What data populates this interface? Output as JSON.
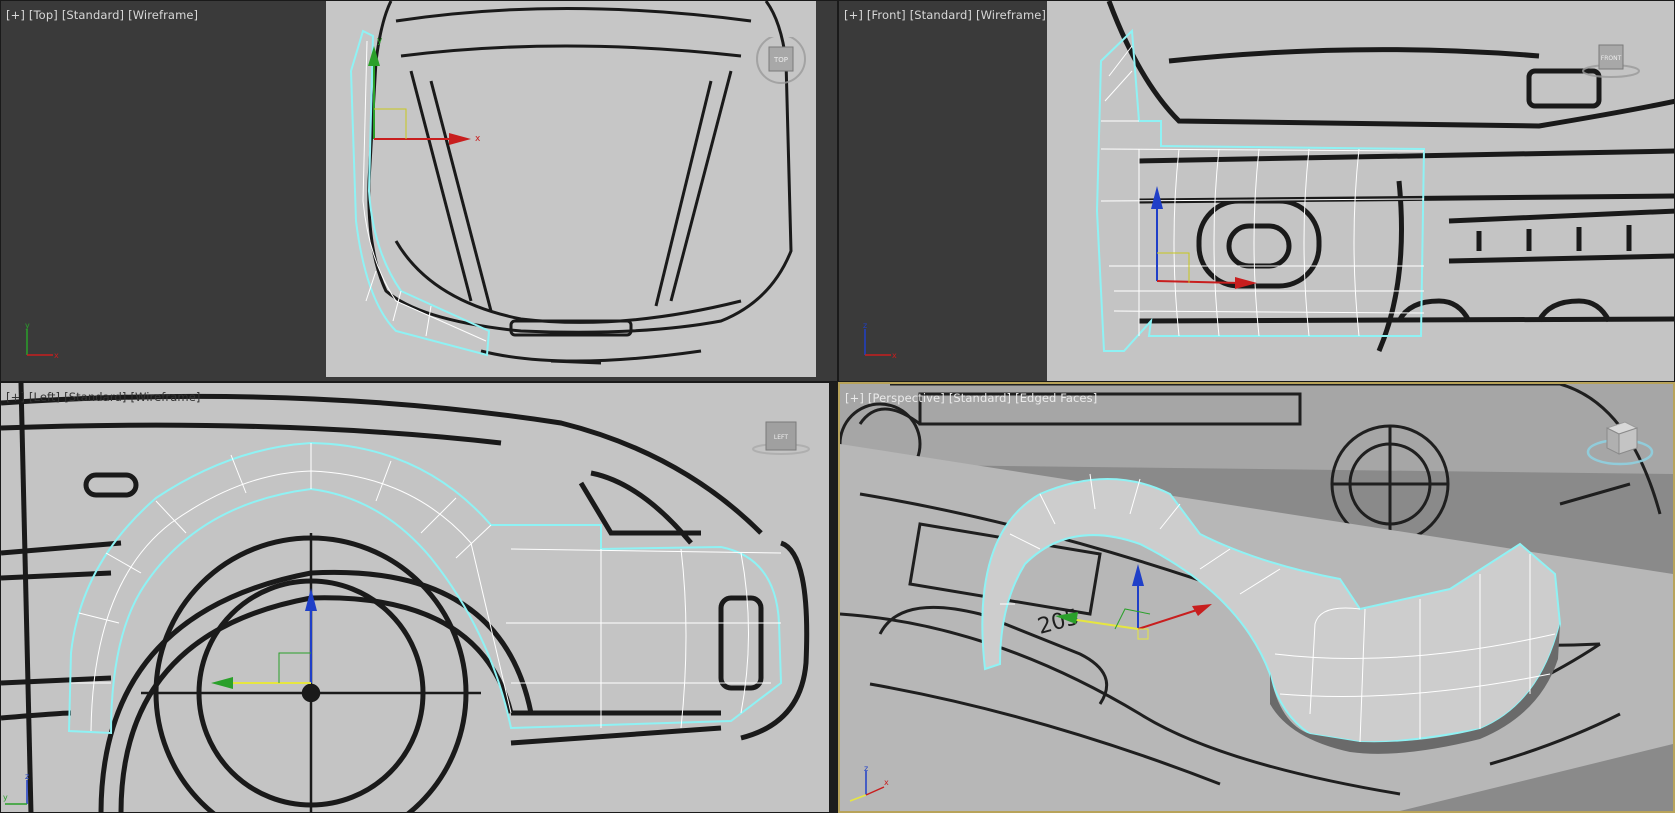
{
  "viewports": {
    "top": {
      "label": [
        "[+]",
        "[Top]",
        "[Standard]",
        "[Wireframe]"
      ],
      "viewcube_label": "TOP",
      "gizmo": {
        "x": "x",
        "y": "y"
      }
    },
    "front": {
      "label": [
        "[+]",
        "[Front]",
        "[Standard]",
        "[Wireframe]"
      ],
      "viewcube_label": "FRONT",
      "gizmo": {
        "x": "x",
        "z": "z"
      }
    },
    "left": {
      "label": [
        "[+]",
        "[Left]",
        "[Standard]",
        "[Wireframe]"
      ],
      "viewcube_label": "LEFT",
      "gizmo": {
        "y": "y",
        "z": "z"
      }
    },
    "perspective": {
      "label": [
        "[+]",
        "[Perspective]",
        "[Standard]",
        "[Edged Faces]"
      ],
      "gizmo": {
        "z": "z",
        "x": "x",
        "y": "y"
      },
      "active": true
    }
  },
  "colors": {
    "viewport_bg": "#3a3a3a",
    "blueprint_bg": "#c4c4c4",
    "selection": "#8ff2f4",
    "wire": "#ffffff",
    "axis_x": "#c81e1e",
    "axis_y": "#2aa02a",
    "axis_z": "#1f3fc8",
    "active_border": "#b8a35a"
  }
}
